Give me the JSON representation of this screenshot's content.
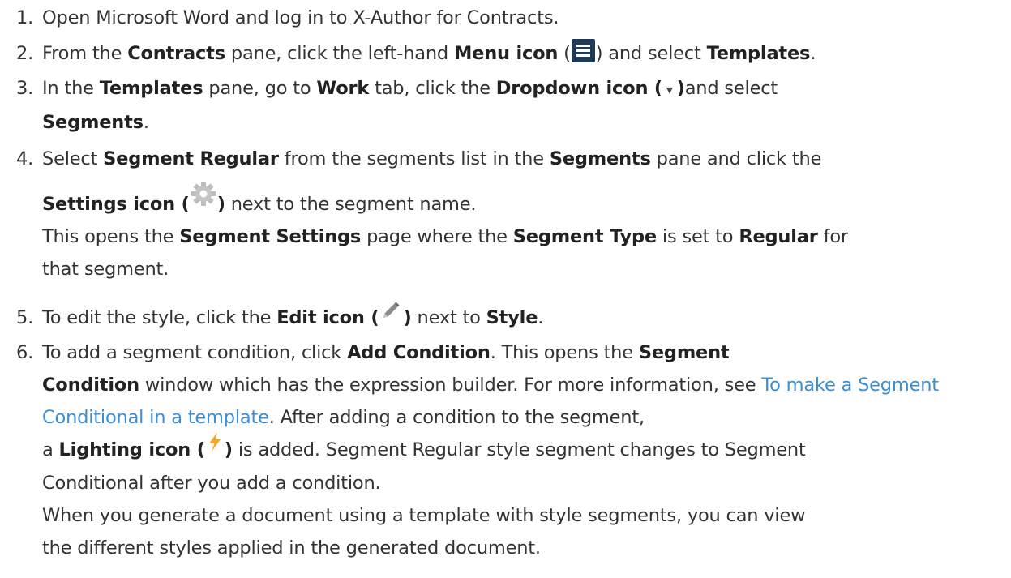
{
  "steps": [
    {
      "num": "1.",
      "t1": "Open Microsoft Word and log in to X-Author for Contracts."
    },
    {
      "num": "2.",
      "t1": "From the ",
      "b1": "Contracts",
      "t2": " pane, click the left-hand ",
      "b2": "Menu icon",
      "t3": " (",
      "t4": ") and select ",
      "b3": "Templates",
      "t5": "."
    },
    {
      "num": "3.",
      "t1": "In the ",
      "b1": "Templates",
      "t2": " pane, go to ",
      "b2": "Work",
      "t3": " tab, click the ",
      "b3": "Dropdown icon (",
      "glyph": " ▾ ",
      "b4": ")",
      "t4": "and select",
      "b5": "Segments",
      "t5": "."
    },
    {
      "num": "4.",
      "t1": "Select ",
      "b1": "Segment Regular",
      "t2": " from the segments list in the ",
      "b2": "Segments",
      "t3": " pane and click the",
      "b3": "Settings icon (",
      "b4": ")",
      "t4": " next to the segment name.",
      "t5": "This opens the ",
      "b5": "Segment Settings",
      "t6": " page where the ",
      "b6": "Segment Type",
      "t7": " is set to ",
      "b7": "Regular",
      "t8": " for",
      "t9": "that segment."
    },
    {
      "num": "5.",
      "t1": "To edit the style, click the ",
      "b1": "Edit icon (",
      "b2": ")",
      "t2": " next to ",
      "b3": "Style",
      "t3": "."
    },
    {
      "num": "6.",
      "t1": "To add a segment condition, click ",
      "b1": "Add Condition",
      "t2": ". This opens the ",
      "b2": "Segment",
      "b3": "Condition",
      "t3": " window which has the expression builder. For more information, see ",
      "link": "To make a Segment Conditional in a template",
      "t4": ". After adding a condition to the segment,",
      "t5": "a ",
      "b4": "Lighting icon (",
      "b5": ")",
      "t6": " is added. Segment Regular style segment changes to Segment",
      "t7": "Conditional after you add a condition.",
      "t8": "When you generate a document using a template with style segments, you can view",
      "t9": "the different styles applied in the generated document."
    }
  ],
  "colors": {
    "text": "#333333",
    "link": "#3b8ed6",
    "menu_icon_bg": "#1f3a56",
    "lightning": "#f5a623",
    "gear": "#b8b8b8"
  },
  "icons": [
    "menu-icon",
    "dropdown-icon",
    "gear-icon",
    "pencil-icon",
    "lightning-icon"
  ]
}
